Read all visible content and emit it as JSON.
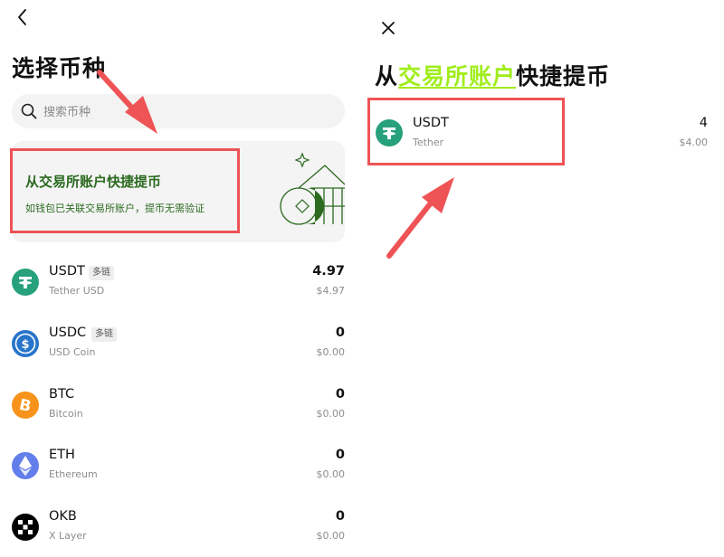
{
  "left": {
    "title": "选择币种",
    "search": {
      "placeholder": "搜索币种",
      "value": ""
    },
    "banner": {
      "title": "从交易所账户快捷提币",
      "subtitle": "如钱包已关联交易所账户，提币无需验证"
    },
    "coins": [
      {
        "symbol": "USDT",
        "badge": "多链",
        "name": "Tether USD",
        "amount": "4.97",
        "value": "$4.97",
        "icon": "tether-icon",
        "color": "#26a17b"
      },
      {
        "symbol": "USDC",
        "badge": "多链",
        "name": "USD Coin",
        "amount": "0",
        "value": "$0.00",
        "icon": "usdc-icon",
        "color": "#2775ca"
      },
      {
        "symbol": "BTC",
        "badge": "",
        "name": "Bitcoin",
        "amount": "0",
        "value": "$0.00",
        "icon": "bitcoin-icon",
        "color": "#f7931a"
      },
      {
        "symbol": "ETH",
        "badge": "",
        "name": "Ethereum",
        "amount": "0",
        "value": "$0.00",
        "icon": "ethereum-icon",
        "color": "#627eea"
      },
      {
        "symbol": "OKB",
        "badge": "",
        "name": "X Layer",
        "amount": "0",
        "value": "$0.00",
        "icon": "okb-icon",
        "color": "#000000"
      }
    ]
  },
  "right": {
    "title_prefix": "从",
    "title_highlight": "交易所账户",
    "title_suffix": "快捷提币",
    "coin": {
      "symbol": "USDT",
      "name": "Tether",
      "amount": "4",
      "value": "$4.00",
      "icon": "tether-icon",
      "color": "#26a17b"
    }
  },
  "colors": {
    "banner_green": "#2b6a1f",
    "highlight_red": "#ee5356",
    "title_highlight": "#a0ed1c"
  }
}
